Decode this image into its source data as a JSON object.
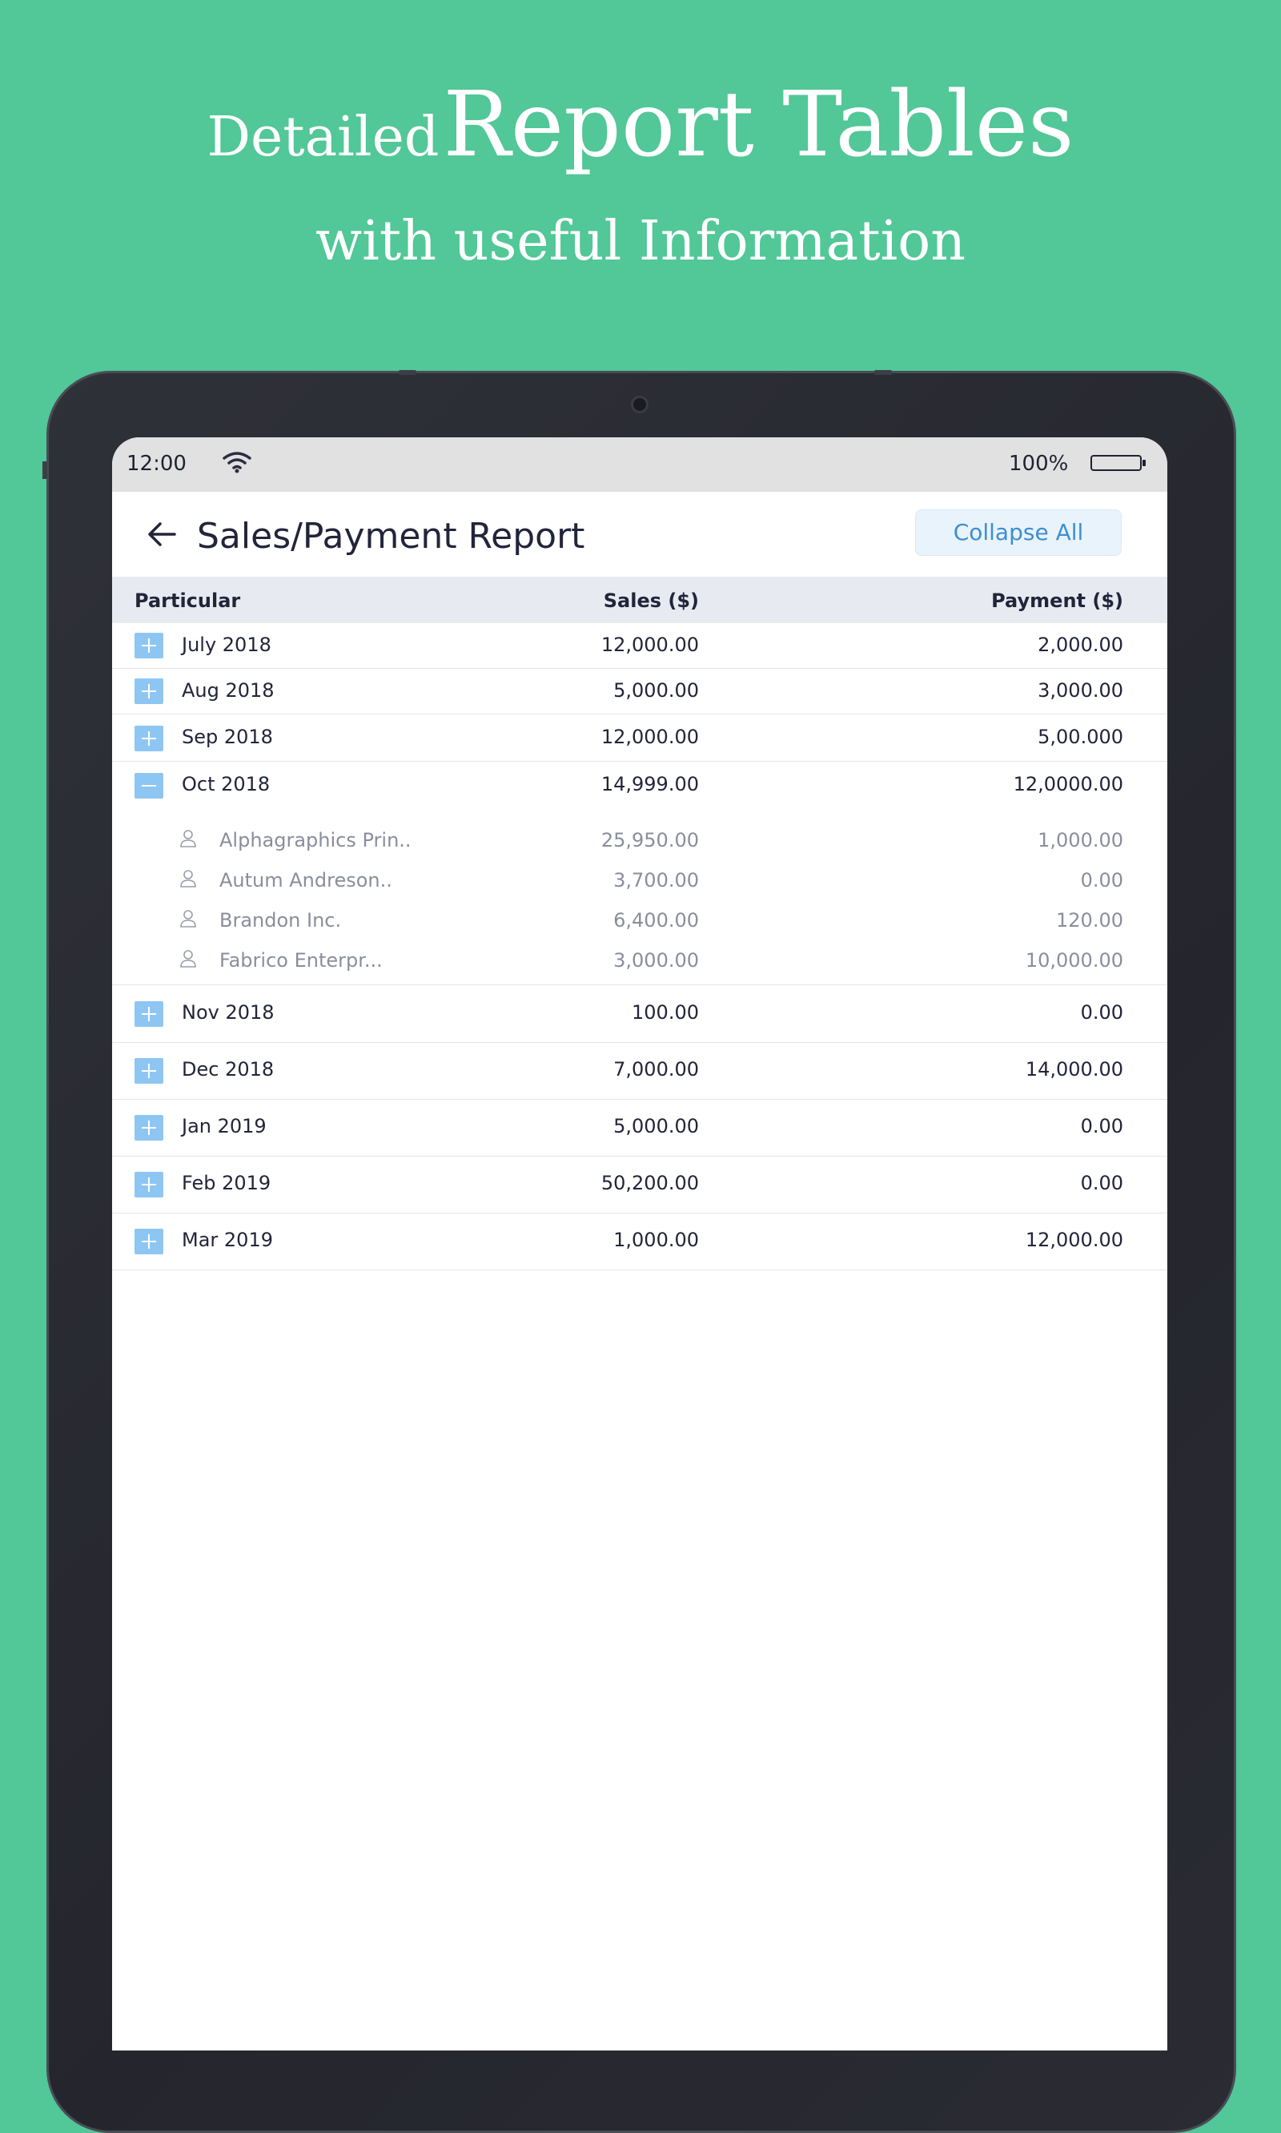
{
  "promo": {
    "headline_small": "Detailed",
    "headline_big": "Report Tables",
    "subheadline": "with useful Information"
  },
  "status_bar": {
    "time": "12:00",
    "battery_percent": "100%"
  },
  "app_bar": {
    "title": "Sales/Payment Report",
    "collapse_label": "Collapse All"
  },
  "table": {
    "headers": {
      "particular": "Particular",
      "sales": "Sales ($)",
      "payment": "Payment ($)"
    },
    "rows": [
      {
        "label": "July 2018",
        "sales": "12,000.00",
        "payment": "2,000.00",
        "expanded": false
      },
      {
        "label": "Aug 2018",
        "sales": "5,000.00",
        "payment": "3,000.00",
        "expanded": false
      },
      {
        "label": "Sep 2018",
        "sales": "12,000.00",
        "payment": "5,00.000",
        "expanded": false
      },
      {
        "label": "Oct 2018",
        "sales": "14,999.00",
        "payment": "12,0000.00",
        "expanded": true,
        "children": [
          {
            "label": "Alphagraphics Prin..",
            "sales": "25,950.00",
            "payment": "1,000.00"
          },
          {
            "label": "Autum Andreson..",
            "sales": "3,700.00",
            "payment": "0.00"
          },
          {
            "label": "Brandon Inc.",
            "sales": "6,400.00",
            "payment": "120.00"
          },
          {
            "label": "Fabrico Enterpr...",
            "sales": "3,000.00",
            "payment": "10,000.00"
          }
        ]
      },
      {
        "label": "Nov 2018",
        "sales": "100.00",
        "payment": "0.00",
        "expanded": false
      },
      {
        "label": "Dec 2018",
        "sales": "7,000.00",
        "payment": "14,000.00",
        "expanded": false
      },
      {
        "label": "Jan 2019",
        "sales": "5,000.00",
        "payment": "0.00",
        "expanded": false
      },
      {
        "label": "Feb 2019",
        "sales": "50,200.00",
        "payment": "0.00",
        "expanded": false
      },
      {
        "label": "Mar 2019",
        "sales": "1,000.00",
        "payment": "12,000.00",
        "expanded": false
      }
    ]
  },
  "colors": {
    "background": "#52c797",
    "toggle": "#8ec6f3",
    "collapse_button_text": "#3d8fd1",
    "header_row": "#e8eaf1"
  }
}
